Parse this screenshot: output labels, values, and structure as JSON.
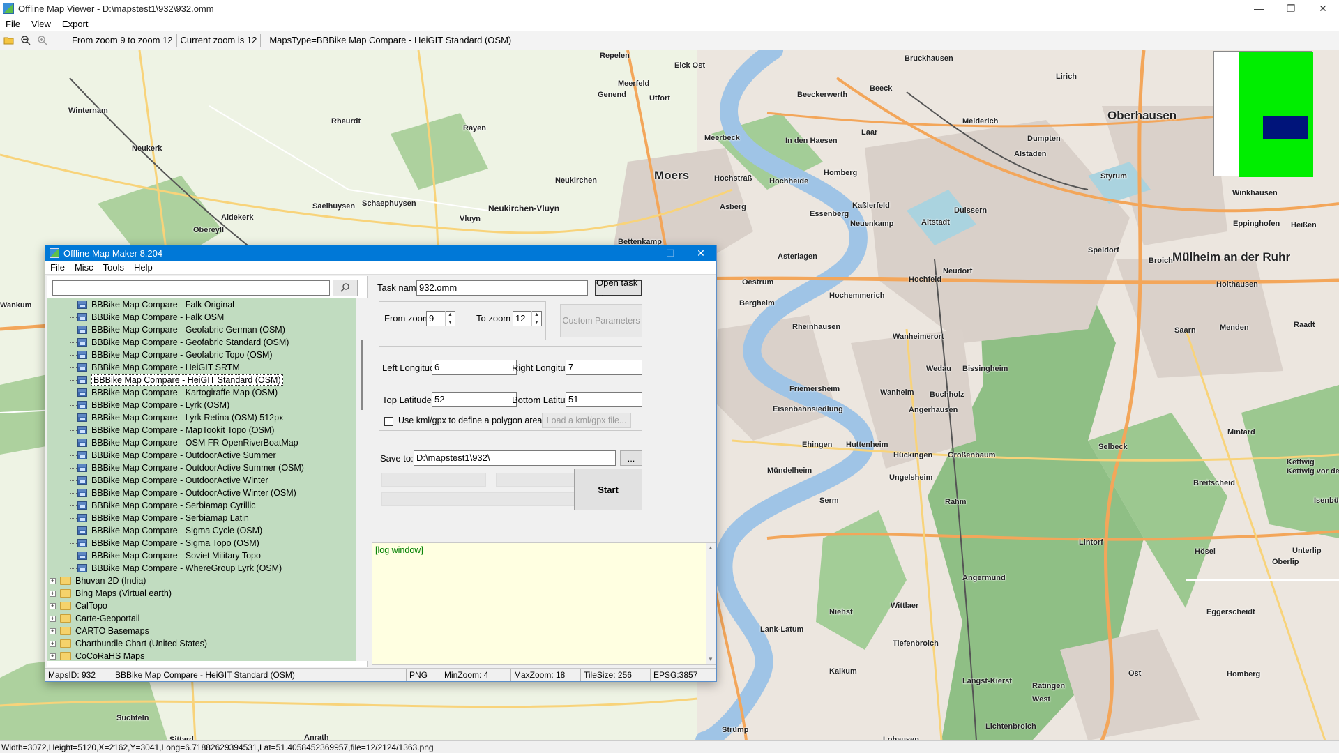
{
  "window": {
    "title": "Offline Map Viewer - D:\\mapstest1\\932\\932.omm",
    "minimize": "—",
    "maximize": "❐",
    "close": "✕"
  },
  "menu": {
    "file": "File",
    "view": "View",
    "export": "Export"
  },
  "toolbar": {
    "zoom_range": "From zoom 9 to zoom 12",
    "current_zoom": "Current zoom is 12",
    "maps_type": "MapsType=BBBike Map Compare - HeiGIT Standard (OSM)"
  },
  "map_labels": [
    "Repelen",
    "Eick Ost",
    "Bruckhausen",
    "Winternam",
    "Meerfeld",
    "Lirich",
    "Oberhausen",
    "Genend",
    "Utfort",
    "Beeckerwerth",
    "Beeck",
    "Rheurdt",
    "Rayen",
    "Meerbeck",
    "In den Haesen",
    "Laar",
    "Meiderich",
    "Dumpten",
    "Neukerk",
    "Moers",
    "Hochstraß",
    "Hochheide",
    "Homberg",
    "Alstaden",
    "Styrum",
    "Neukirchen",
    "Saelhuysen",
    "Schaephuysen",
    "Neukirchen-Vluyn",
    "Asberg",
    "Kaßlerfeld",
    "Duissern",
    "Winkhausen",
    "Aldekerk",
    "Vluyn",
    "Essenberg",
    "Neuenkamp",
    "Altstadt",
    "Eppinghofen",
    "Heißen",
    "Obereyll",
    "Bettenkamp",
    "Speldorf",
    "Broich",
    "Mülheim an der Ruhr",
    "Asterlagen",
    "Neudorf",
    "Holthausen",
    "Oestrum",
    "Hochfeld",
    "Wankum",
    "Bergheim",
    "Hochemmerich",
    "Saarn",
    "Raadt",
    "Menden",
    "Rheinhausen",
    "Wanheimerort",
    "Wedau",
    "Bissingheim",
    "Wanheim",
    "Friemersheim",
    "Buchholz",
    "Eisenbahnsiedlung",
    "Angerhausen",
    "Mintard",
    "Ehingen",
    "Huttenheim",
    "Hückingen",
    "Großenbaum",
    "Selbeck",
    "Kettwig",
    "Kettwig vor der Brücke",
    "Mündelheim",
    "Ungelsheim",
    "Breitscheid",
    "Serm",
    "Rahm",
    "Isenbügel",
    "Lintorf",
    "Hösel",
    "Unterlip",
    "Oberlip",
    "Angermund",
    "Niehst",
    "Wittlaer",
    "Eggerscheidt",
    "Lank-Latum",
    "Tiefenbroich",
    "Kalkum",
    "Langst-Kierst",
    "Ratingen",
    "Ost",
    "Homberg",
    "West",
    "Suchteln",
    "Strümp",
    "Lichtenbroich",
    "Sittard",
    "Anrath",
    "Lohausen"
  ],
  "statusbar": {
    "text": "Width=3072,Height=5120,X=2162,Y=3041,Long=6.71882629394531,Lat=51.4058452369957,file=12/2124/1363.png"
  },
  "dialog": {
    "title": "Offline Map Maker 8.204",
    "minimize": "—",
    "maximize": "☐",
    "close": "✕",
    "menu": {
      "file": "File",
      "misc": "Misc",
      "tools": "Tools",
      "help": "Help"
    },
    "search": {
      "value": "",
      "placeholder": ""
    },
    "tree": {
      "children": [
        "BBBike Map Compare - Falk Original",
        "BBBike Map Compare - Falk OSM",
        "BBBike Map Compare - Geofabric German (OSM)",
        "BBBike Map Compare - Geofabric Standard (OSM)",
        "BBBike Map Compare - Geofabric Topo (OSM)",
        "BBBike Map Compare - HeiGIT SRTM",
        "BBBike Map Compare - HeiGIT Standard (OSM)",
        "BBBike Map Compare - Kartogiraffe Map (OSM)",
        "BBBike Map Compare - Lyrk (OSM)",
        "BBBike Map Compare - Lyrk Retina (OSM) 512px",
        "BBBike Map Compare - MapTookit Topo (OSM)",
        "BBBike Map Compare - OSM FR OpenRiverBoatMap",
        "BBBike Map Compare - OutdoorActive Summer",
        "BBBike Map Compare - OutdoorActive Summer (OSM)",
        "BBBike Map Compare - OutdoorActive Winter",
        "BBBike Map Compare - OutdoorActive Winter (OSM)",
        "BBBike Map Compare - Serbiamap Cyrillic",
        "BBBike Map Compare - Serbiamap Latin",
        "BBBike Map Compare - Sigma Cycle (OSM)",
        "BBBike Map Compare - Sigma Topo (OSM)",
        "BBBike Map Compare - Soviet Military Topo",
        "BBBike Map Compare - WhereGroup Lyrk (OSM)"
      ],
      "selected": "BBBike Map Compare - HeiGIT Standard (OSM)",
      "groups": [
        "Bhuvan-2D (India)",
        "Bing Maps (Virtual earth)",
        "CalTopo",
        "Carte-Geoportail",
        "CARTO Basemaps",
        "Chartbundle Chart (United States)",
        "CoCoRaHS Maps"
      ]
    },
    "task": {
      "name_label": "Task name",
      "name_value": "932.omm",
      "open_task": "Open task ...",
      "from_zoom_label": "From zoom",
      "from_zoom": "9",
      "to_zoom_label": "To zoom",
      "to_zoom": "12",
      "custom_params": "Custom Parameters",
      "left_lon_label": "Left Longitude",
      "left_lon": "6",
      "right_lon_label": "Right Longitude",
      "right_lon": "7",
      "top_lat_label": "Top Latitude",
      "top_lat": "52",
      "bottom_lat_label": "Bottom Latitude",
      "bottom_lat": "51",
      "kml_label": "Use kml/gpx to define a polygon area",
      "load_kml": "Load a kml/gpx file...",
      "save_label": "Save to:",
      "save_path": "D:\\mapstest1\\932\\",
      "browse": "...",
      "start": "Start"
    },
    "log": "[log window]",
    "status": {
      "maps_id": "MapsID: 932",
      "maps_name": "BBBike Map Compare - HeiGIT Standard (OSM)",
      "format": "PNG",
      "min_zoom": "MinZoom: 4",
      "max_zoom": "MaxZoom: 18",
      "tile_size": "TileSize: 256",
      "epsg": "EPSG:3857"
    }
  },
  "colors": {
    "title_accent": "#0078d7",
    "tree_bg": "#c1dcc0",
    "log_bg": "#ffffe1",
    "minimap_green": "#00ee00",
    "minimap_navy": "#00147a"
  }
}
